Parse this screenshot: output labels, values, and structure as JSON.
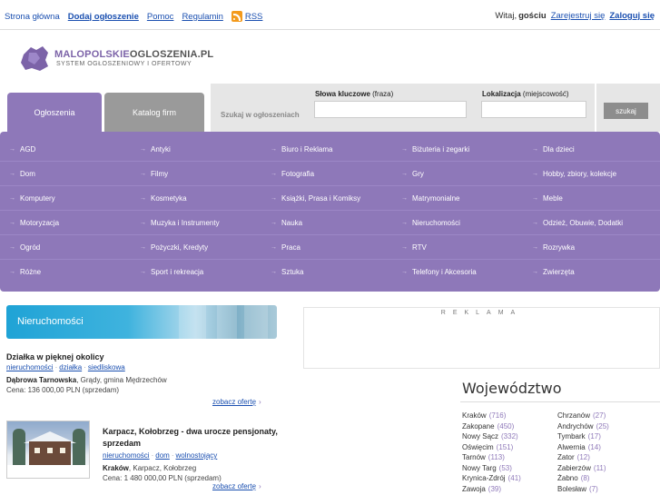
{
  "topbar": {
    "links": [
      "Strona główna",
      "Dodaj ogłoszenie",
      "Pomoc",
      "Regulamin"
    ],
    "rss_label": "RSS",
    "greeting_prefix": "Witaj,",
    "greeting_user": "gościu",
    "register": "Zarejestruj się",
    "login": "Zaloguj się"
  },
  "logo": {
    "name_a": "MALOPOLSKIE",
    "name_b": "OGLOSZENIA.PL",
    "subtitle": "SYSTEM OGŁOSZENIOWY I OFERTOWY"
  },
  "tabs": {
    "ads": "Ogłoszenia",
    "catalog": "Katalog firm"
  },
  "search": {
    "label": "Szukaj w ogłoszeniach",
    "keywords_label": "Słowa kluczowe",
    "keywords_hint": "(fraza)",
    "location_label": "Lokalizacja",
    "location_hint": "(miejscowość)",
    "button": "szukaj"
  },
  "categories": [
    [
      "AGD",
      "Antyki",
      "Biuro i Reklama",
      "Biżuteria i zegarki",
      "Dla dzieci"
    ],
    [
      "Dom",
      "Filmy",
      "Fotografia",
      "Gry",
      "Hobby, zbiory, kolekcje"
    ],
    [
      "Komputery",
      "Kosmetyka",
      "Książki, Prasa i Komiksy",
      "Matrymonialne",
      "Meble"
    ],
    [
      "Motoryzacja",
      "Muzyka i Instrumenty",
      "Nauka",
      "Nieruchomości",
      "Odzież, Obuwie, Dodatki"
    ],
    [
      "Ogród",
      "Pożyczki, Kredyty",
      "Praca",
      "RTV",
      "Rozrywka"
    ],
    [
      "Różne",
      "Sport i rekreacja",
      "Sztuka",
      "Telefony i Akcesoria",
      "Zwierzęta"
    ]
  ],
  "banner": {
    "label": "Nieruchomości"
  },
  "offers": [
    {
      "title": "Działka w pięknej okolicy",
      "tags": [
        "nieruchomości",
        "działka",
        "siedliskowa"
      ],
      "loc_bold": "Dąbrowa Tarnowska",
      "loc_rest": ", Grądy, gmina Mędrzechów",
      "price": "Cena: 136 000,00 PLN (sprzedam)",
      "more": "zobacz ofertę"
    },
    {
      "title": "Karpacz, Kołobrzeg - dwa urocze pensjonaty, sprzedam",
      "tags": [
        "nieruchomości",
        "dom",
        "wolnostojący"
      ],
      "loc_bold": "Kraków",
      "loc_rest": ", Karpacz, Kołobrzeg",
      "price": "Cena: 1 480 000,00 PLN (sprzedam)",
      "more": "zobacz ofertę"
    }
  ],
  "ad_label": "REKLAMA",
  "voivodeship": {
    "title": "Województwo",
    "col1": [
      {
        "name": "Kraków",
        "count": "(716)"
      },
      {
        "name": "Zakopane",
        "count": "(450)"
      },
      {
        "name": "Nowy Sącz",
        "count": "(332)"
      },
      {
        "name": "Oświęcim",
        "count": "(151)"
      },
      {
        "name": "Tarnów",
        "count": "(113)"
      },
      {
        "name": "Nowy Targ",
        "count": "(53)"
      },
      {
        "name": "Krynica-Zdrój",
        "count": "(41)"
      },
      {
        "name": "Zawoja",
        "count": "(39)"
      }
    ],
    "col2": [
      {
        "name": "Chrzanów",
        "count": "(27)"
      },
      {
        "name": "Andrychów",
        "count": "(25)"
      },
      {
        "name": "Tymbark",
        "count": "(17)"
      },
      {
        "name": "Alwernia",
        "count": "(14)"
      },
      {
        "name": "Zator",
        "count": "(12)"
      },
      {
        "name": "Zabierzów",
        "count": "(11)"
      },
      {
        "name": "Żabno",
        "count": "(8)"
      },
      {
        "name": "Bolesław",
        "count": "(7)"
      }
    ]
  },
  "colors": {
    "accent": "#8e78b9",
    "link": "#1a4fb0",
    "rss": "#f39a1c"
  }
}
